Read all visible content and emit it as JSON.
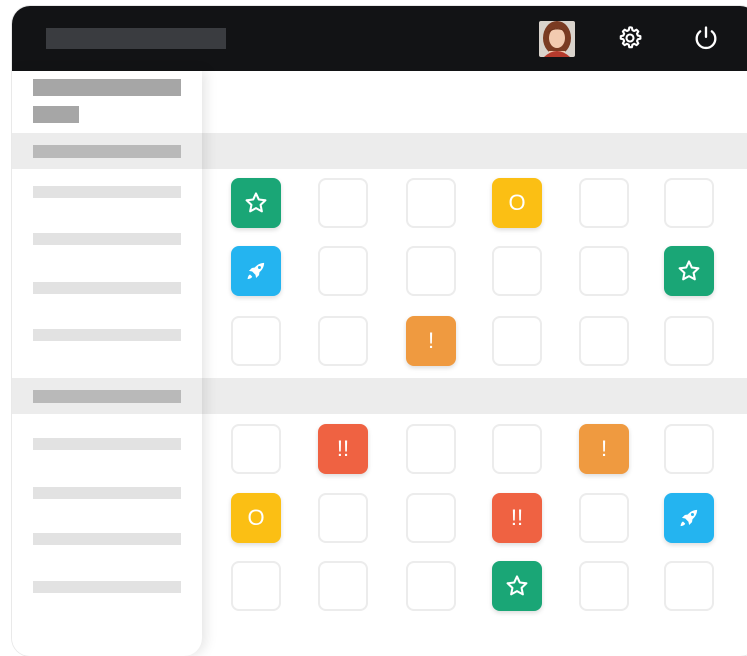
{
  "header": {
    "user_avatar": "avatar",
    "icons": [
      "settings-gear-icon",
      "power-icon"
    ]
  },
  "colors": {
    "header_bg": "#121315",
    "star": "#1aa676",
    "rocket": "#24b4f0",
    "o": "#fbbf14",
    "single_exclamation": "#ef9a40",
    "double_exclamation": "#ef6242"
  },
  "grid": {
    "group1": [
      [
        "star",
        "",
        "",
        "O",
        "",
        ""
      ],
      [
        "rocket",
        "",
        "",
        "",
        "",
        "star"
      ],
      [
        "",
        "",
        "!",
        "",
        "",
        ""
      ]
    ],
    "group2": [
      [
        "",
        "!!",
        "",
        "",
        "!",
        ""
      ],
      [
        "O",
        "",
        "",
        "!!",
        "",
        "rocket"
      ],
      [
        "",
        "",
        "",
        "star",
        "",
        ""
      ]
    ]
  }
}
